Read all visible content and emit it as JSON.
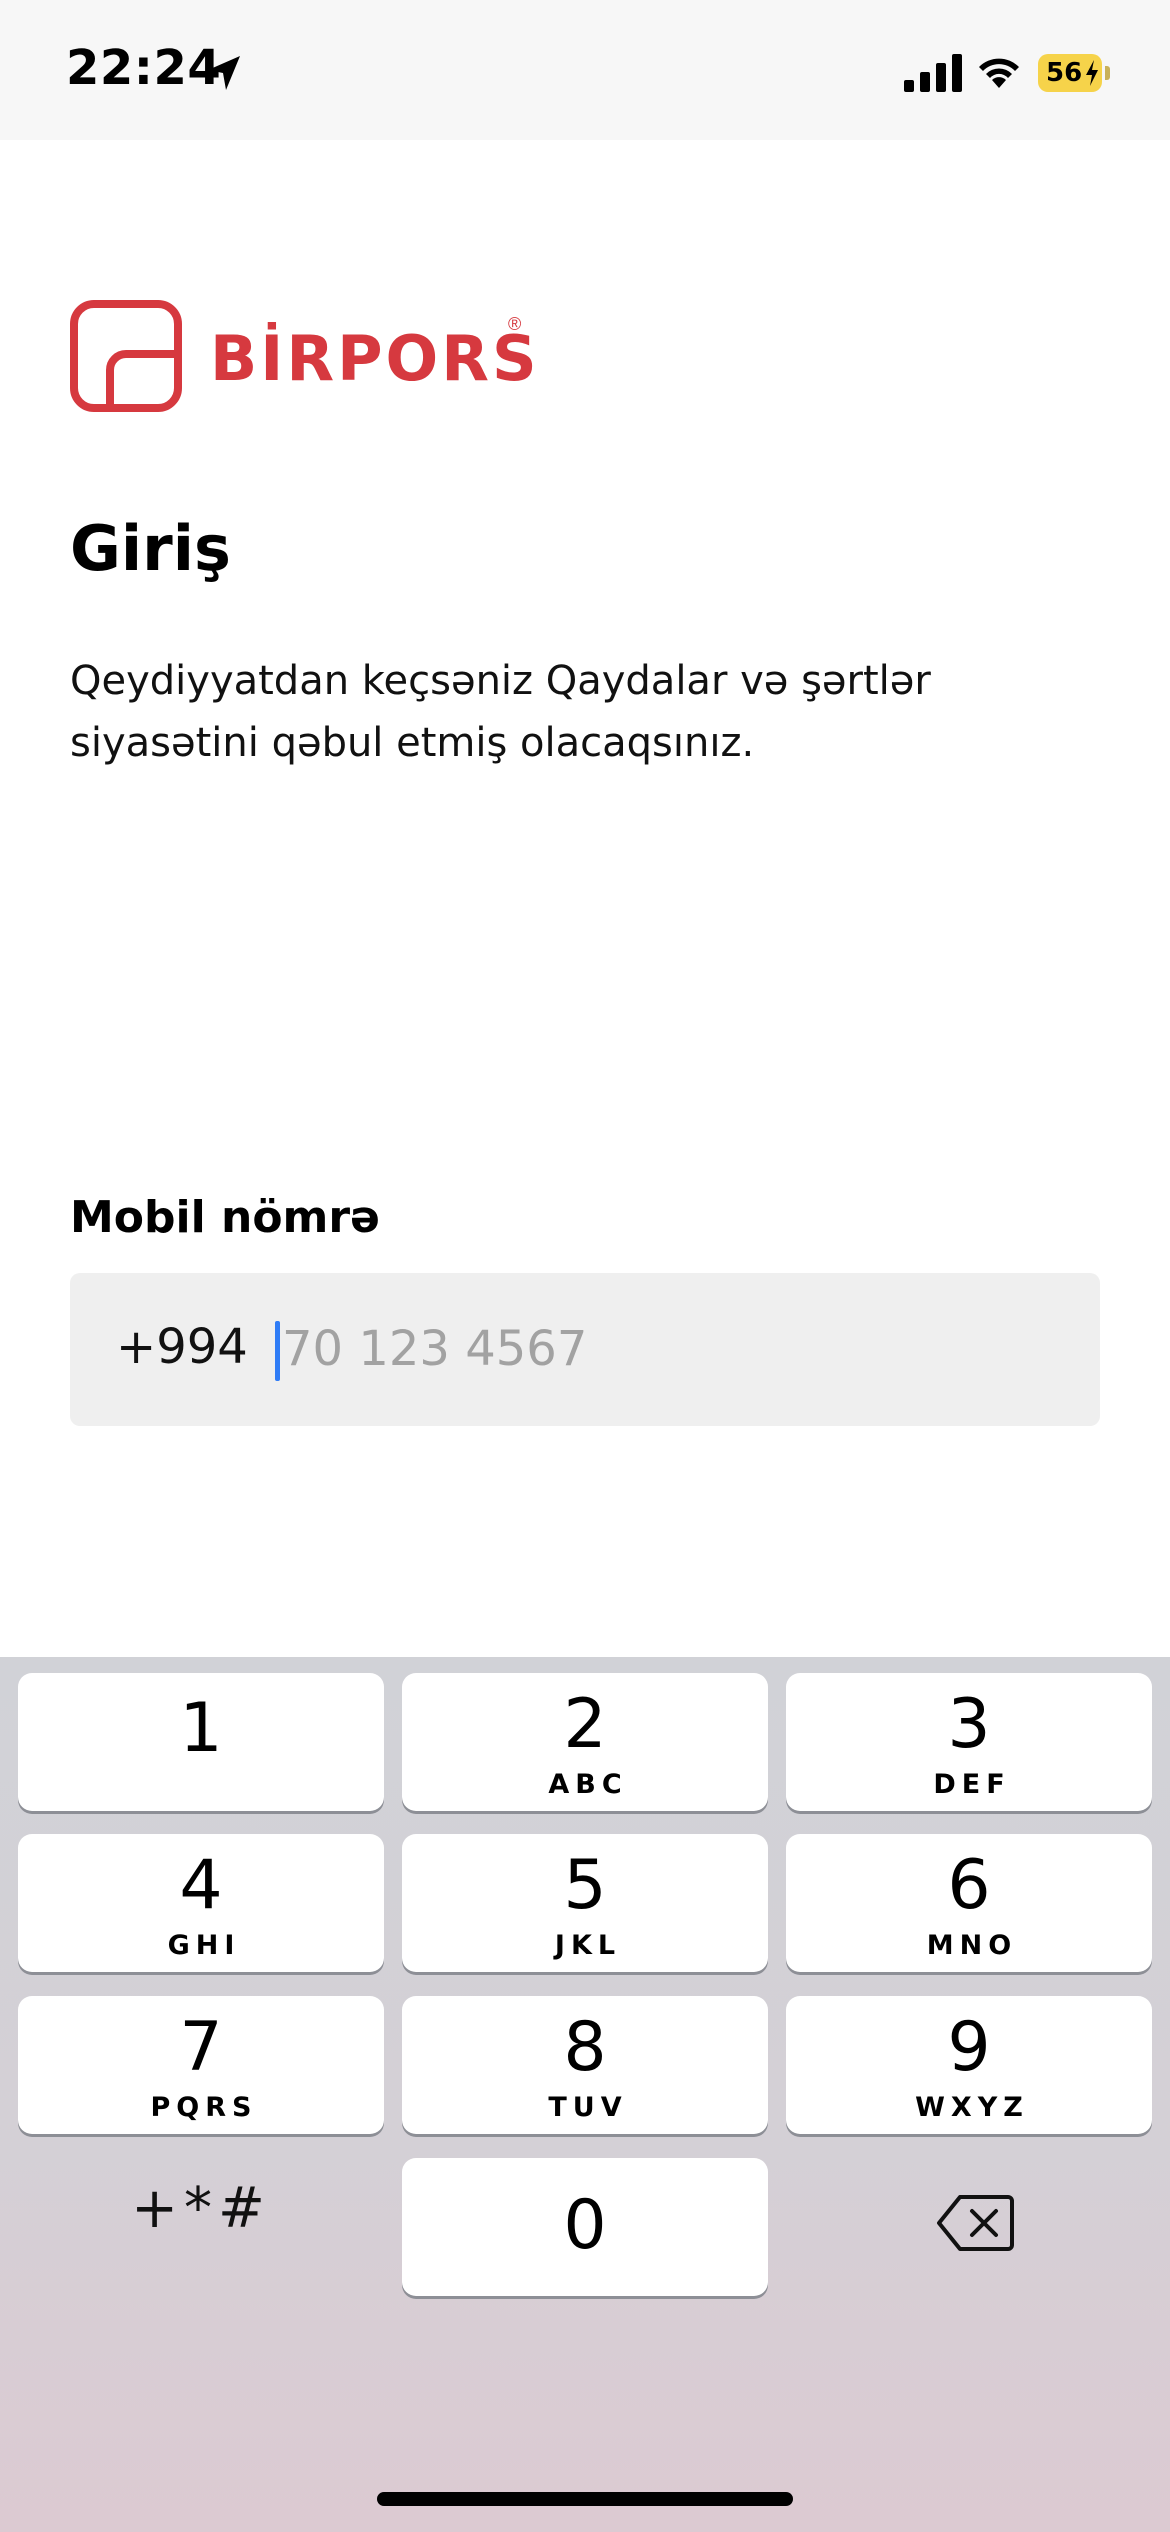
{
  "status_bar": {
    "time": "22:24",
    "battery": "56",
    "battery_color": "#f6d34a"
  },
  "brand": {
    "name": "BİRPORS",
    "reg_mark": "®",
    "color": "#d6393f"
  },
  "login": {
    "title": "Giriş",
    "description": "Qeydiyyatdan keçsəniz Qaydalar və şərtlər siyasətini qəbul etmiş olacaqsınız.",
    "phone_label": "Mobil nömrə",
    "country_code": "+994",
    "phone_placeholder": "70 123 4567",
    "phone_value": ""
  },
  "keypad": {
    "keys": [
      {
        "num": "1",
        "letters": ""
      },
      {
        "num": "2",
        "letters": "ABC"
      },
      {
        "num": "3",
        "letters": "DEF"
      },
      {
        "num": "4",
        "letters": "GHI"
      },
      {
        "num": "5",
        "letters": "JKL"
      },
      {
        "num": "6",
        "letters": "MNO"
      },
      {
        "num": "7",
        "letters": "PQRS"
      },
      {
        "num": "8",
        "letters": "TUV"
      },
      {
        "num": "9",
        "letters": "WXYZ"
      },
      {
        "num": "0",
        "letters": ""
      }
    ],
    "symbols_label": "+*#"
  }
}
